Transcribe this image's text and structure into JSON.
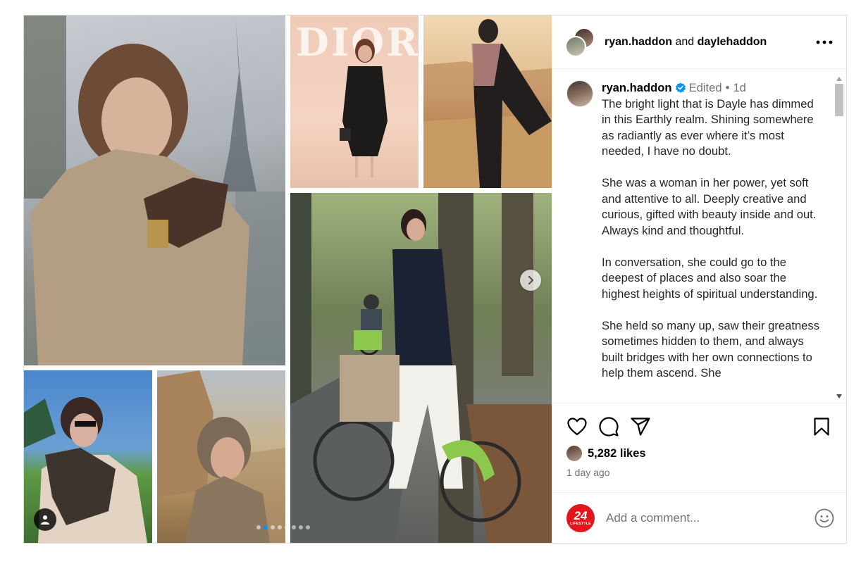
{
  "post": {
    "header": {
      "user1": "ryan.haddon",
      "conjunction": "and",
      "user2": "daylehaddon",
      "more_icon": "more-horizontal-icon"
    },
    "media": {
      "photos": [
        {
          "name": "photo-coat-paris"
        },
        {
          "name": "photo-dior-event",
          "sign_text": "DIOR"
        },
        {
          "name": "photo-desert-cliff"
        },
        {
          "name": "photo-bike-ride"
        },
        {
          "name": "photo-goat"
        },
        {
          "name": "photo-sphinx"
        }
      ],
      "carousel_count": 8,
      "carousel_active": 1
    },
    "caption": {
      "username": "ryan.haddon",
      "verified": true,
      "edited": "Edited",
      "separator": "•",
      "time": "1d",
      "paragraphs": [
        "The bright light that is Dayle has dimmed in this Earthly realm. Shining somewhere as radiantly as ever where it’s most needed, I have no doubt.",
        "She was a woman in her power, yet soft and attentive to all. Deeply creative and curious, gifted with beauty inside and out. Always kind and thoughtful.",
        "In conversation, she could go to the deepest of places and also soar the highest heights of spiritual understanding.",
        "She held so many up, saw their greatness sometimes hidden to them, and always built bridges with her own connections to help them ascend. She"
      ]
    },
    "actions": {
      "icons": [
        "heart-icon",
        "comment-icon",
        "share-icon",
        "bookmark-icon"
      ]
    },
    "likes": "5,282 likes",
    "time_ago": "1 day ago",
    "comment_box": {
      "logo_text": "24",
      "logo_subtext": "LIFESTYLE",
      "placeholder": "Add a comment..."
    }
  }
}
